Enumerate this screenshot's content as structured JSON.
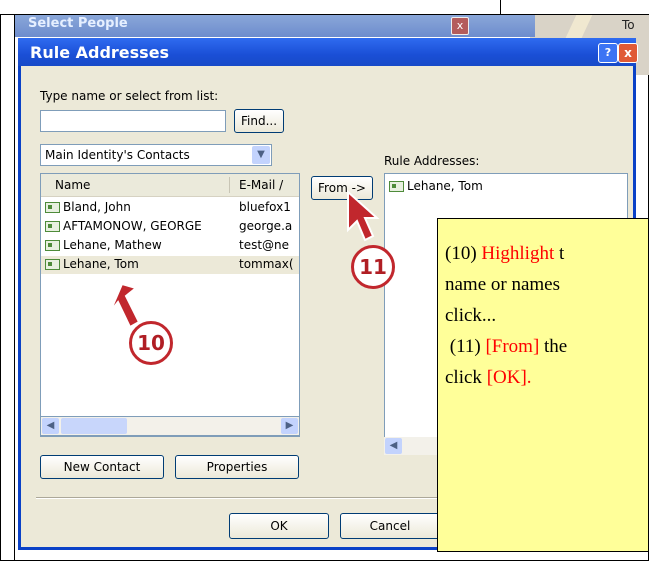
{
  "background_window": {
    "title": "Select People",
    "close_glyph": "x",
    "right_label": "To"
  },
  "dialog": {
    "title": "Rule Addresses",
    "help_glyph": "?",
    "close_glyph": "x",
    "type_label": "Type name or select from list:",
    "find_button": "Find...",
    "address_book": "Main Identity's Contacts",
    "list": {
      "columns": [
        "Name",
        "E-Mail /"
      ],
      "rows": [
        {
          "name": "Bland, John",
          "email": "bluefox1"
        },
        {
          "name": "AFTAMONOW, GEORGE",
          "email": "george.a"
        },
        {
          "name": "Lehane, Mathew",
          "email": "test@ne"
        },
        {
          "name": "Lehane, Tom",
          "email": "tommax("
        }
      ],
      "selected_index": 3
    },
    "from_button": "From ->",
    "rule_addresses_label": "Rule Addresses:",
    "rule_addresses": [
      "Lehane, Tom"
    ],
    "new_contact_button": "New Contact",
    "properties_button": "Properties",
    "ok_button": "OK",
    "cancel_button": "Cancel"
  },
  "callouts": {
    "highlight": "10",
    "from": "11"
  },
  "annotation": {
    "line1_prefix": "(10) ",
    "line1_red": "Highlight",
    "line1_rest": " t",
    "line2": "name or names",
    "line3": "click...",
    "line4_prefix": " (11) ",
    "line4_red": "[From]",
    "line4_rest": " the",
    "line5_prefix": "click ",
    "line5_red": "[OK]."
  },
  "colors": {
    "titlebar": "#1a4fd6",
    "dialog_face": "#ece9d8",
    "note_fill": "#ffff99",
    "callout_red": "#c1272d",
    "highlight_red": "#ff0000"
  }
}
